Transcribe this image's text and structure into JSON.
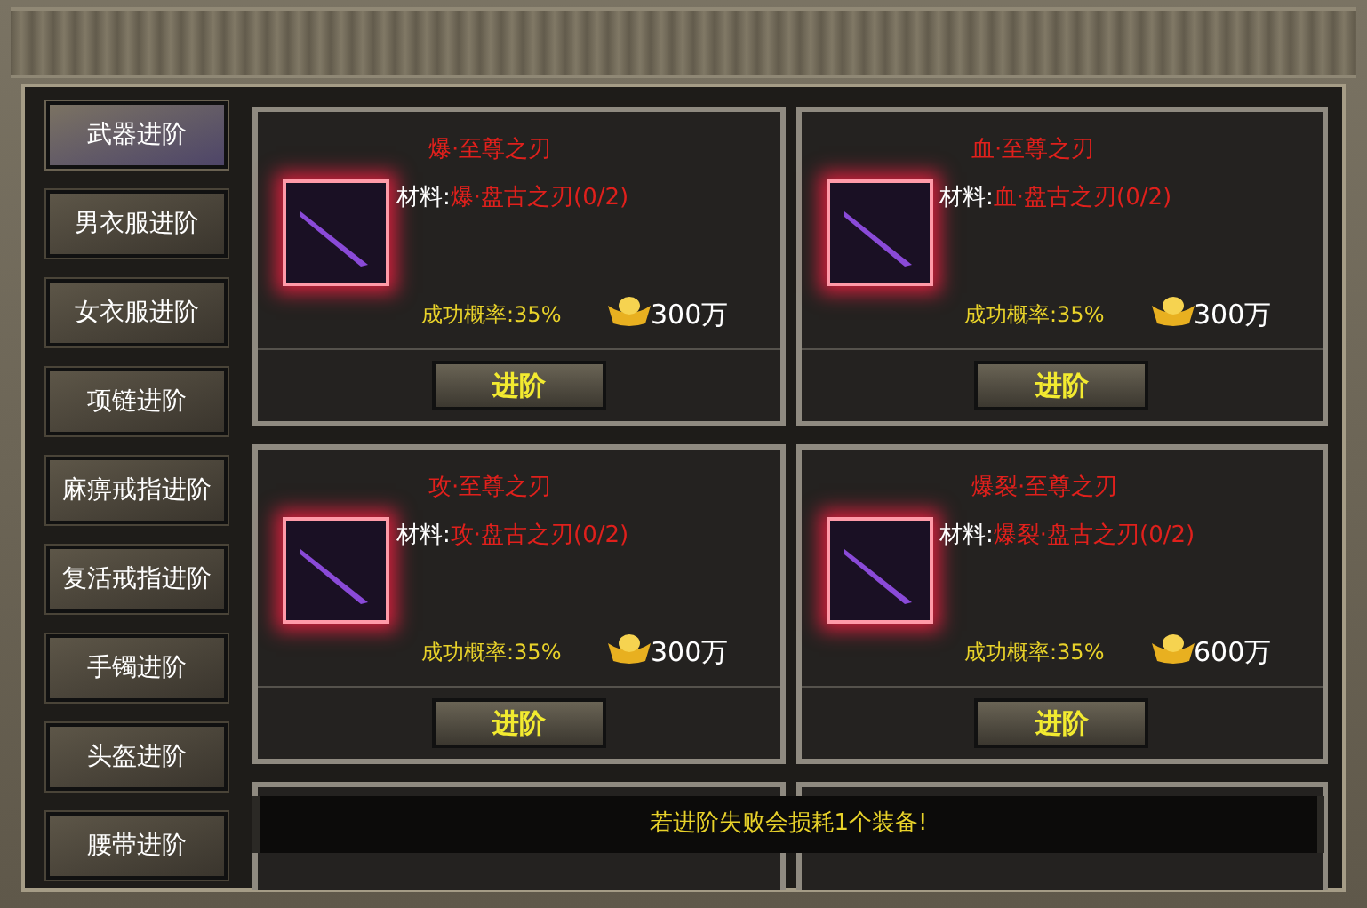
{
  "tabs": [
    {
      "label": "武器进阶",
      "selected": true
    },
    {
      "label": "男衣服进阶",
      "selected": false
    },
    {
      "label": "女衣服进阶",
      "selected": false
    },
    {
      "label": "项链进阶",
      "selected": false
    },
    {
      "label": "麻痹戒指进阶",
      "selected": false
    },
    {
      "label": "复活戒指进阶",
      "selected": false
    },
    {
      "label": "手镯进阶",
      "selected": false
    },
    {
      "label": "头盔进阶",
      "selected": false
    },
    {
      "label": "腰带进阶",
      "selected": false
    }
  ],
  "cards": [
    {
      "title": "爆·至尊之刃",
      "material_label": "材料:",
      "material": "爆·盘古之刃(0/2)",
      "rate": "成功概率:35%",
      "cost": "300万",
      "button": "进阶"
    },
    {
      "title": "血·至尊之刃",
      "material_label": "材料:",
      "material": "血·盘古之刃(0/2)",
      "rate": "成功概率:35%",
      "cost": "300万",
      "button": "进阶"
    },
    {
      "title": "攻·至尊之刃",
      "material_label": "材料:",
      "material": "攻·盘古之刃(0/2)",
      "rate": "成功概率:35%",
      "cost": "300万",
      "button": "进阶"
    },
    {
      "title": "爆裂·至尊之刃",
      "material_label": "材料:",
      "material": "爆裂·盘古之刃(0/2)",
      "rate": "成功概率:35%",
      "cost": "600万",
      "button": "进阶"
    }
  ],
  "notice": "若进阶失败会损耗1个装备!"
}
